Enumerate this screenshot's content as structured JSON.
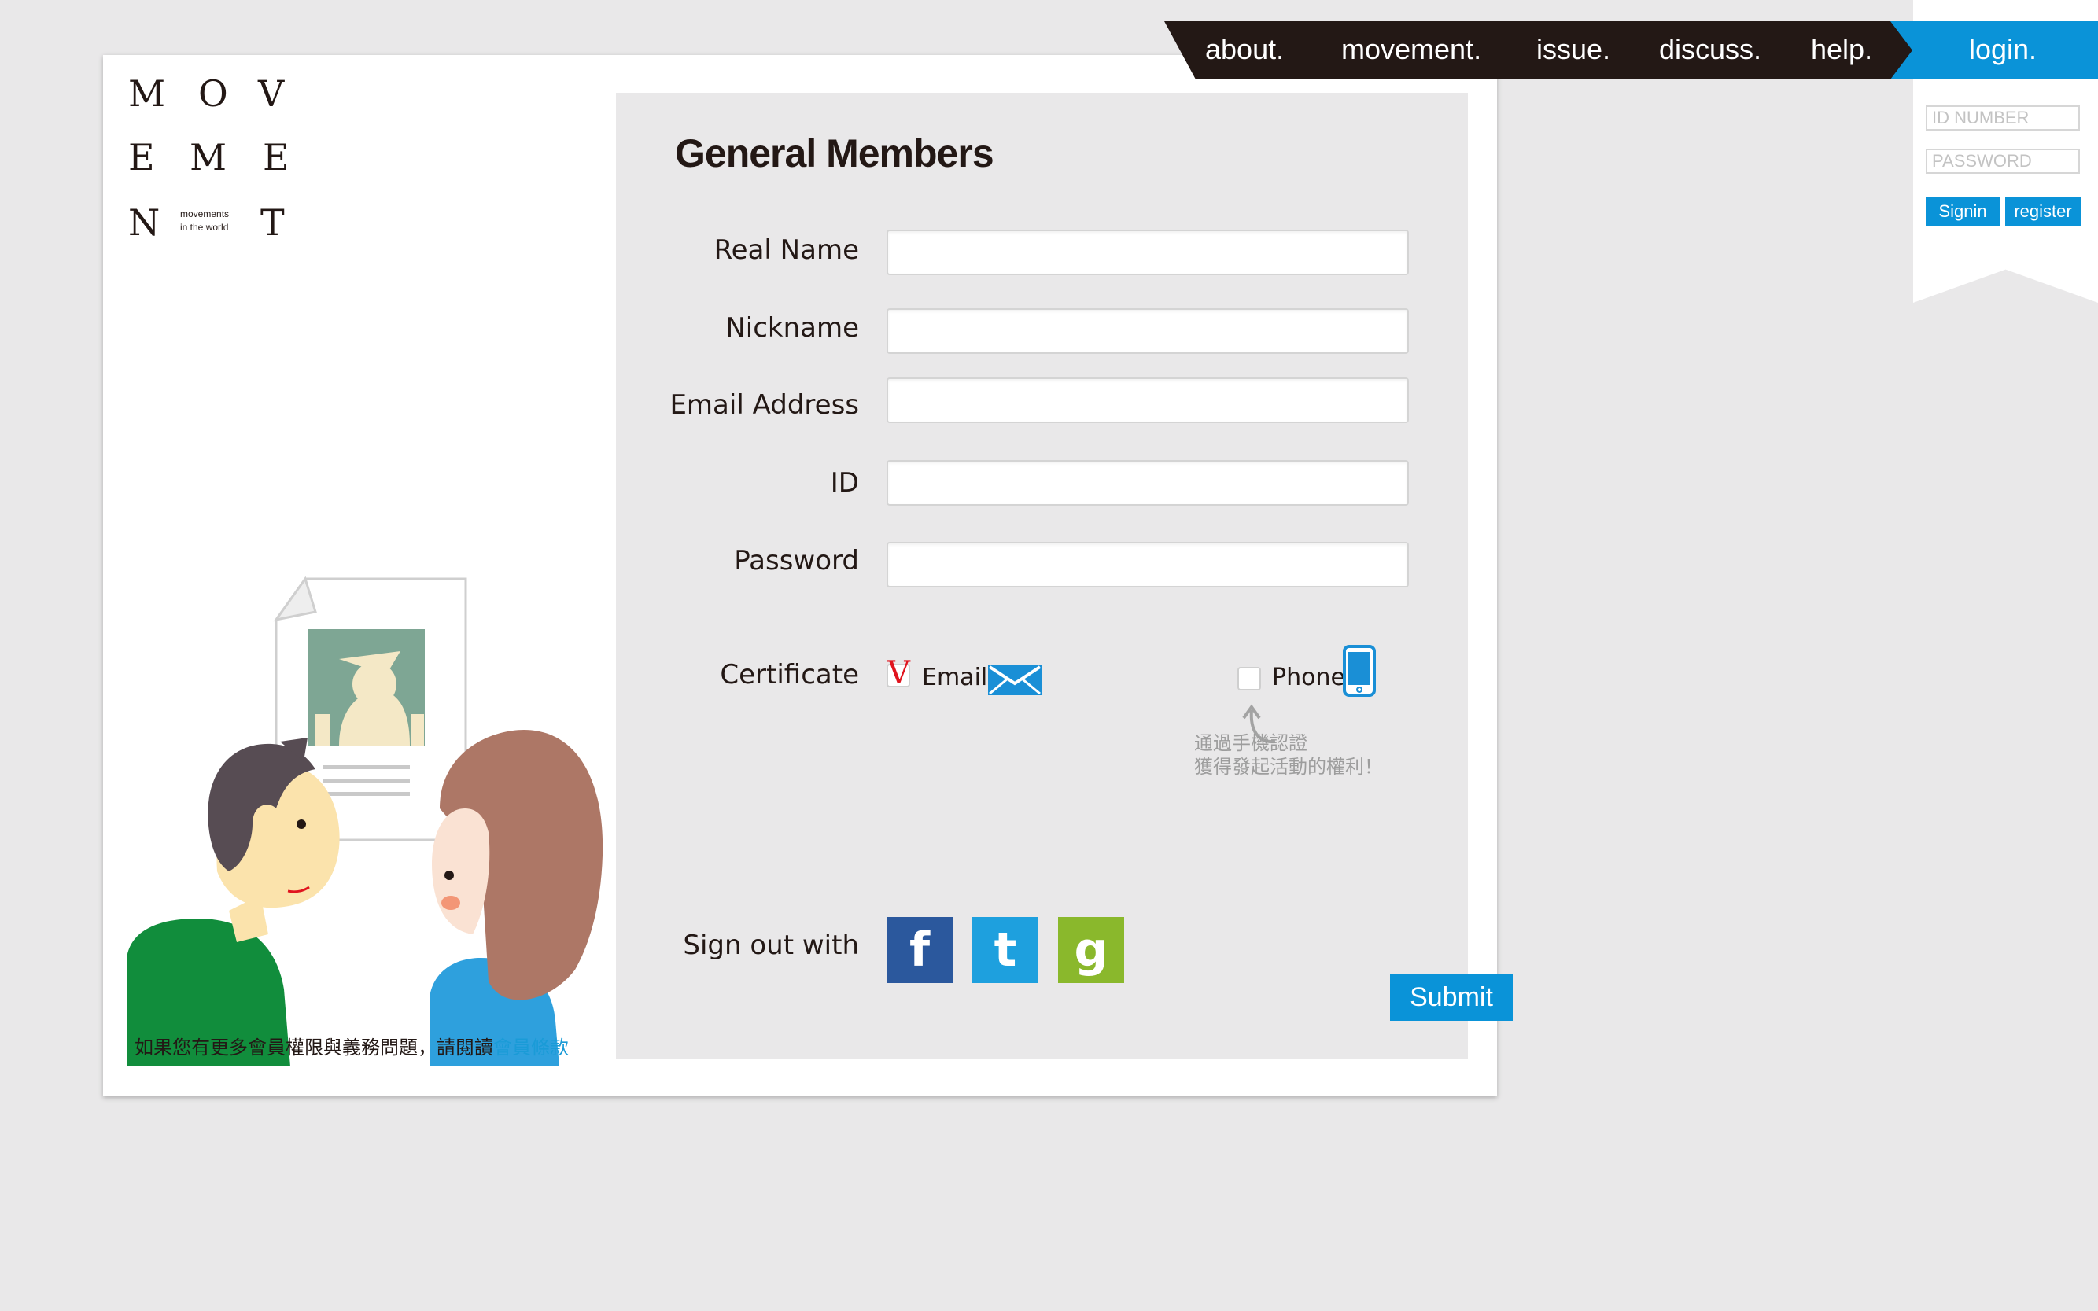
{
  "nav": {
    "items": [
      "about.",
      "movement.",
      "issue.",
      "discuss.",
      "help."
    ],
    "login_tab": "login."
  },
  "login": {
    "id_placeholder": "ID NUMBER",
    "password_placeholder": "PASSWORD",
    "signin_label": "Signin",
    "register_label": "register"
  },
  "logo": {
    "letters": [
      "M",
      "O",
      "V",
      "E",
      "M",
      "E",
      "N",
      "T"
    ],
    "tagline_line1": "movements",
    "tagline_line2": "in the world"
  },
  "form": {
    "title": "General Members",
    "fields": {
      "real_name": "Real Name",
      "nickname": "Nickname",
      "email": "Email Address",
      "id": "ID",
      "password": "Password"
    },
    "certificate": {
      "label": "Certificate",
      "email_option": "Email",
      "email_checked_mark": "V",
      "phone_option": "Phone",
      "phone_note_line1": "通過手機認證",
      "phone_note_line2": "獲得發起活動的權利！"
    },
    "social": {
      "label": "Sign out with",
      "facebook": "f",
      "twitter": "t",
      "google": "g"
    },
    "submit_label": "Submit"
  },
  "footer": {
    "terms_text": "如果您有更多會員權限與義務問題，請閱讀",
    "terms_link": "會員條款"
  },
  "colors": {
    "accent": "#0a93d8",
    "nav_bg": "#231815",
    "panel_bg": "#e9e8e9",
    "facebook": "#2b589d",
    "twitter": "#1ea0de",
    "google": "#8ab82c"
  }
}
